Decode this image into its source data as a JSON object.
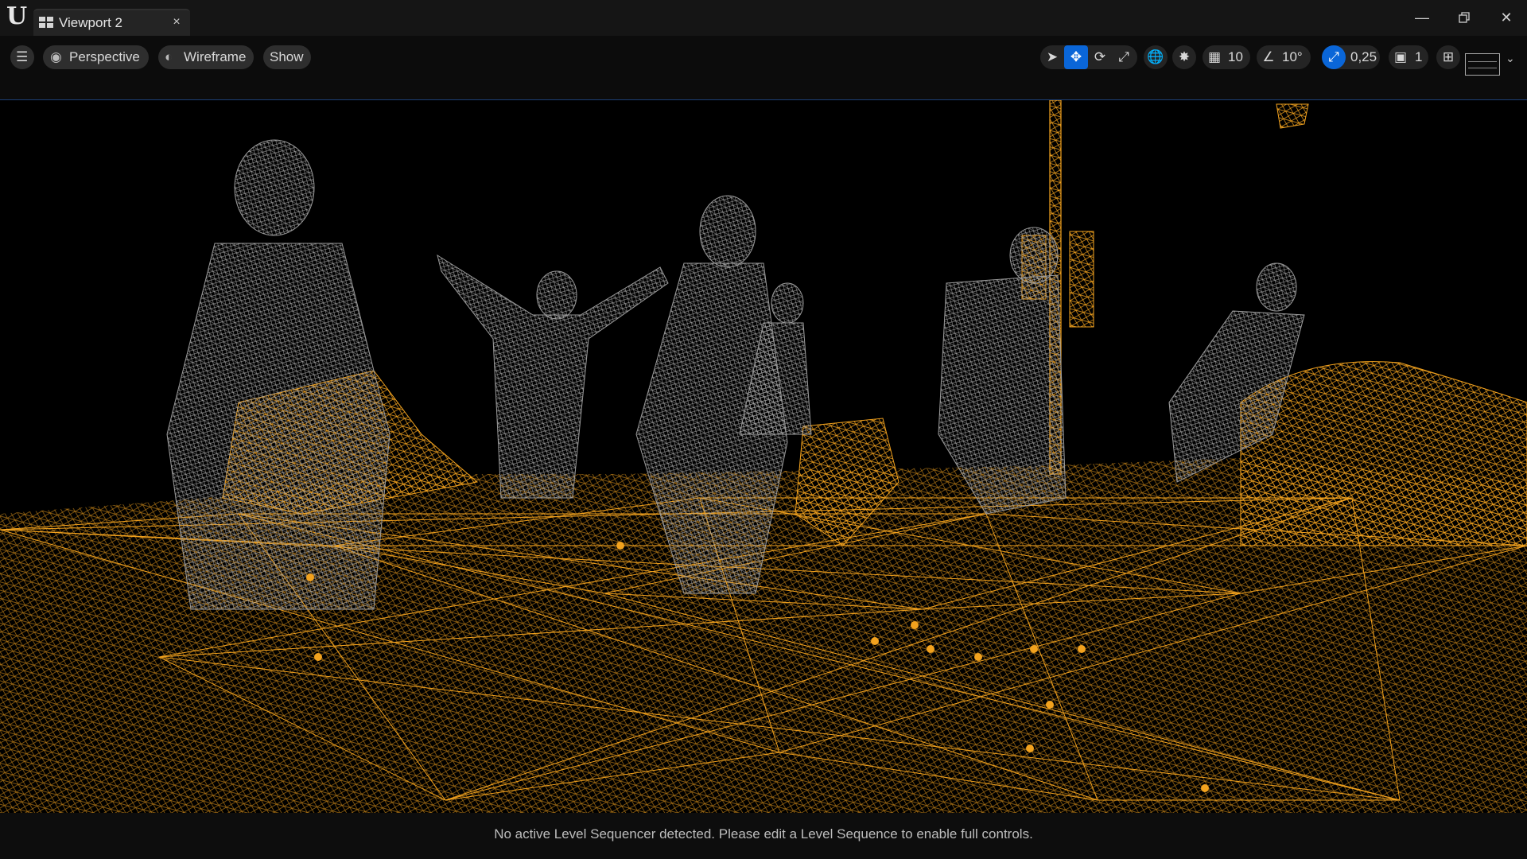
{
  "window": {
    "tab_title": "Viewport 2",
    "close_glyph": "×"
  },
  "toolbar": {
    "perspective_label": "Perspective",
    "view_mode_label": "Wireframe",
    "show_label": "Show",
    "grid_snap_value": "10",
    "rotation_snap_value": "10°",
    "scale_snap_value": "0,25",
    "camera_speed_value": "1"
  },
  "status": {
    "message": "No active Level Sequencer detected. Please edit a Level Sequence to enable full controls."
  },
  "colors": {
    "wire_orange": "#f2a21e",
    "wire_gray": "#9a9a9a",
    "accent_blue": "#0a66d8"
  }
}
